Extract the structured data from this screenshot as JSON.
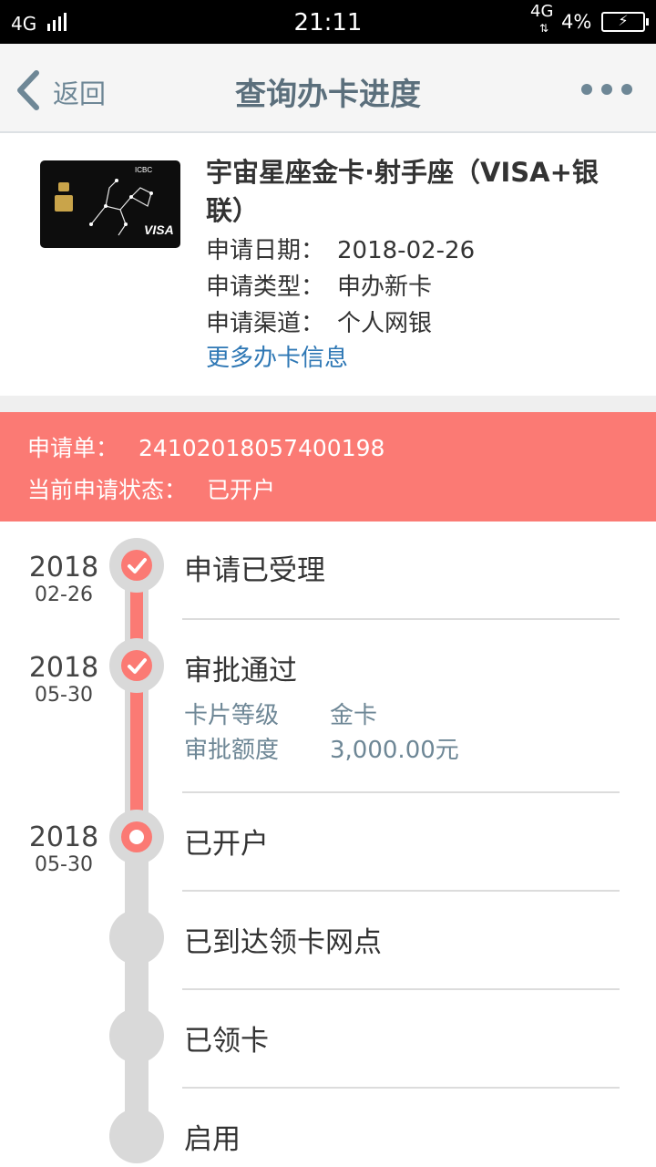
{
  "status_bar": {
    "network": "4G",
    "time": "21:11",
    "network_right": "4G",
    "battery_percent": "4%",
    "charging_icon": "⚡"
  },
  "nav": {
    "back_label": "返回",
    "title": "查询办卡进度"
  },
  "card": {
    "name": "宇宙星座金卡·射手座（VISA+银联）",
    "image_text_bank": "ICBC",
    "image_text_visa": "VISA",
    "rows": [
      {
        "label": "申请日期：",
        "value": "2018-02-26"
      },
      {
        "label": "申请类型：",
        "value": "申办新卡"
      },
      {
        "label": "申请渠道：",
        "value": "个人网银"
      }
    ],
    "more_info_link": "更多办卡信息"
  },
  "application": {
    "number_label": "申请单：",
    "number": "24102018057400198",
    "status_label": "当前申请状态：",
    "status": "已开户"
  },
  "timeline": [
    {
      "year": "2018",
      "md": "02-26",
      "label": "申请已受理",
      "state": "done"
    },
    {
      "year": "2018",
      "md": "05-30",
      "label": "审批通过",
      "state": "done",
      "details": [
        {
          "key": "卡片等级",
          "value": "金卡"
        },
        {
          "key": "审批额度",
          "value": "3,000.00元"
        }
      ]
    },
    {
      "year": "2018",
      "md": "05-30",
      "label": "已开户",
      "state": "current"
    },
    {
      "year": "",
      "md": "",
      "label": "已到达领卡网点",
      "state": "pending"
    },
    {
      "year": "",
      "md": "",
      "label": "已领卡",
      "state": "pending"
    },
    {
      "year": "",
      "md": "",
      "label": "启用",
      "state": "pending"
    }
  ],
  "colors": {
    "accent": "#fb7a74",
    "link": "#2f78b5",
    "nav_text": "#5b6f7c",
    "track_grey": "#d9d9d9"
  }
}
